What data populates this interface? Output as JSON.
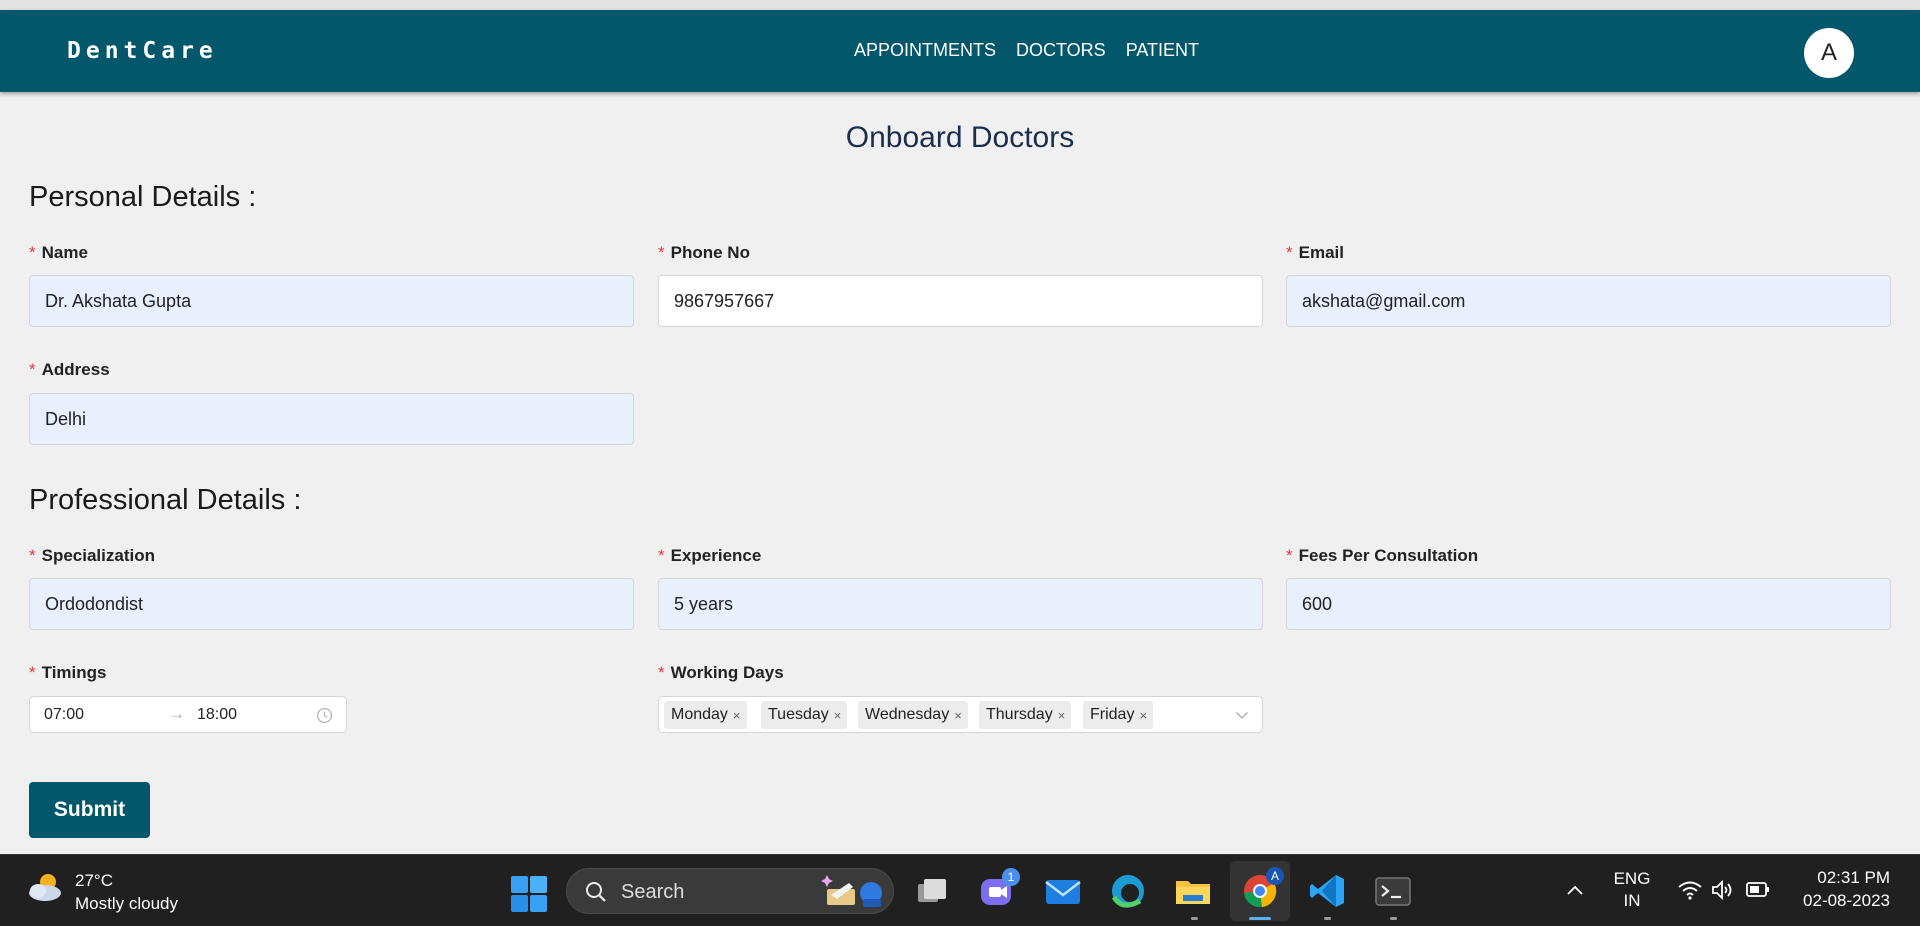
{
  "app": {
    "brand": "DentCare",
    "nav": [
      "APPOINTMENTS",
      "DOCTORS",
      "PATIENT"
    ],
    "avatar_initial": "A"
  },
  "page": {
    "title": "Onboard Doctors",
    "personal_section": "Personal Details :",
    "professional_section": "Professional Details :"
  },
  "required_mark": "*",
  "fields": {
    "name": {
      "label": "Name",
      "value": "Dr. Akshata Gupta"
    },
    "phone": {
      "label": "Phone No",
      "value": "9867957667"
    },
    "email": {
      "label": "Email",
      "value": "akshata@gmail.com"
    },
    "address": {
      "label": "Address",
      "value": "Delhi"
    },
    "specialization": {
      "label": "Specialization",
      "value": "Ordodondist"
    },
    "experience": {
      "label": "Experience",
      "value": "5 years"
    },
    "fees": {
      "label": "Fees Per Consultation",
      "value": "600"
    },
    "timings": {
      "label": "Timings",
      "start": "07:00",
      "end": "18:00",
      "separator": "→"
    },
    "working_days": {
      "label": "Working Days",
      "selected": [
        "Monday",
        "Tuesday",
        "Wednesday",
        "Thursday",
        "Friday"
      ],
      "remove_glyph": "×"
    }
  },
  "submit_label": "Submit",
  "taskbar": {
    "weather_temp": "27°C",
    "weather_cond": "Mostly cloudy",
    "search_label": "Search",
    "chat_badge": "1",
    "chrome_profile": "A",
    "lang_top": "ENG",
    "lang_bottom": "IN",
    "time": "02:31 PM",
    "date": "02-08-2023"
  },
  "colors": {
    "navbar": "#02576a",
    "autofill_bg": "#e8f0fe",
    "required": "#e0383e",
    "taskbar": "#202020"
  }
}
